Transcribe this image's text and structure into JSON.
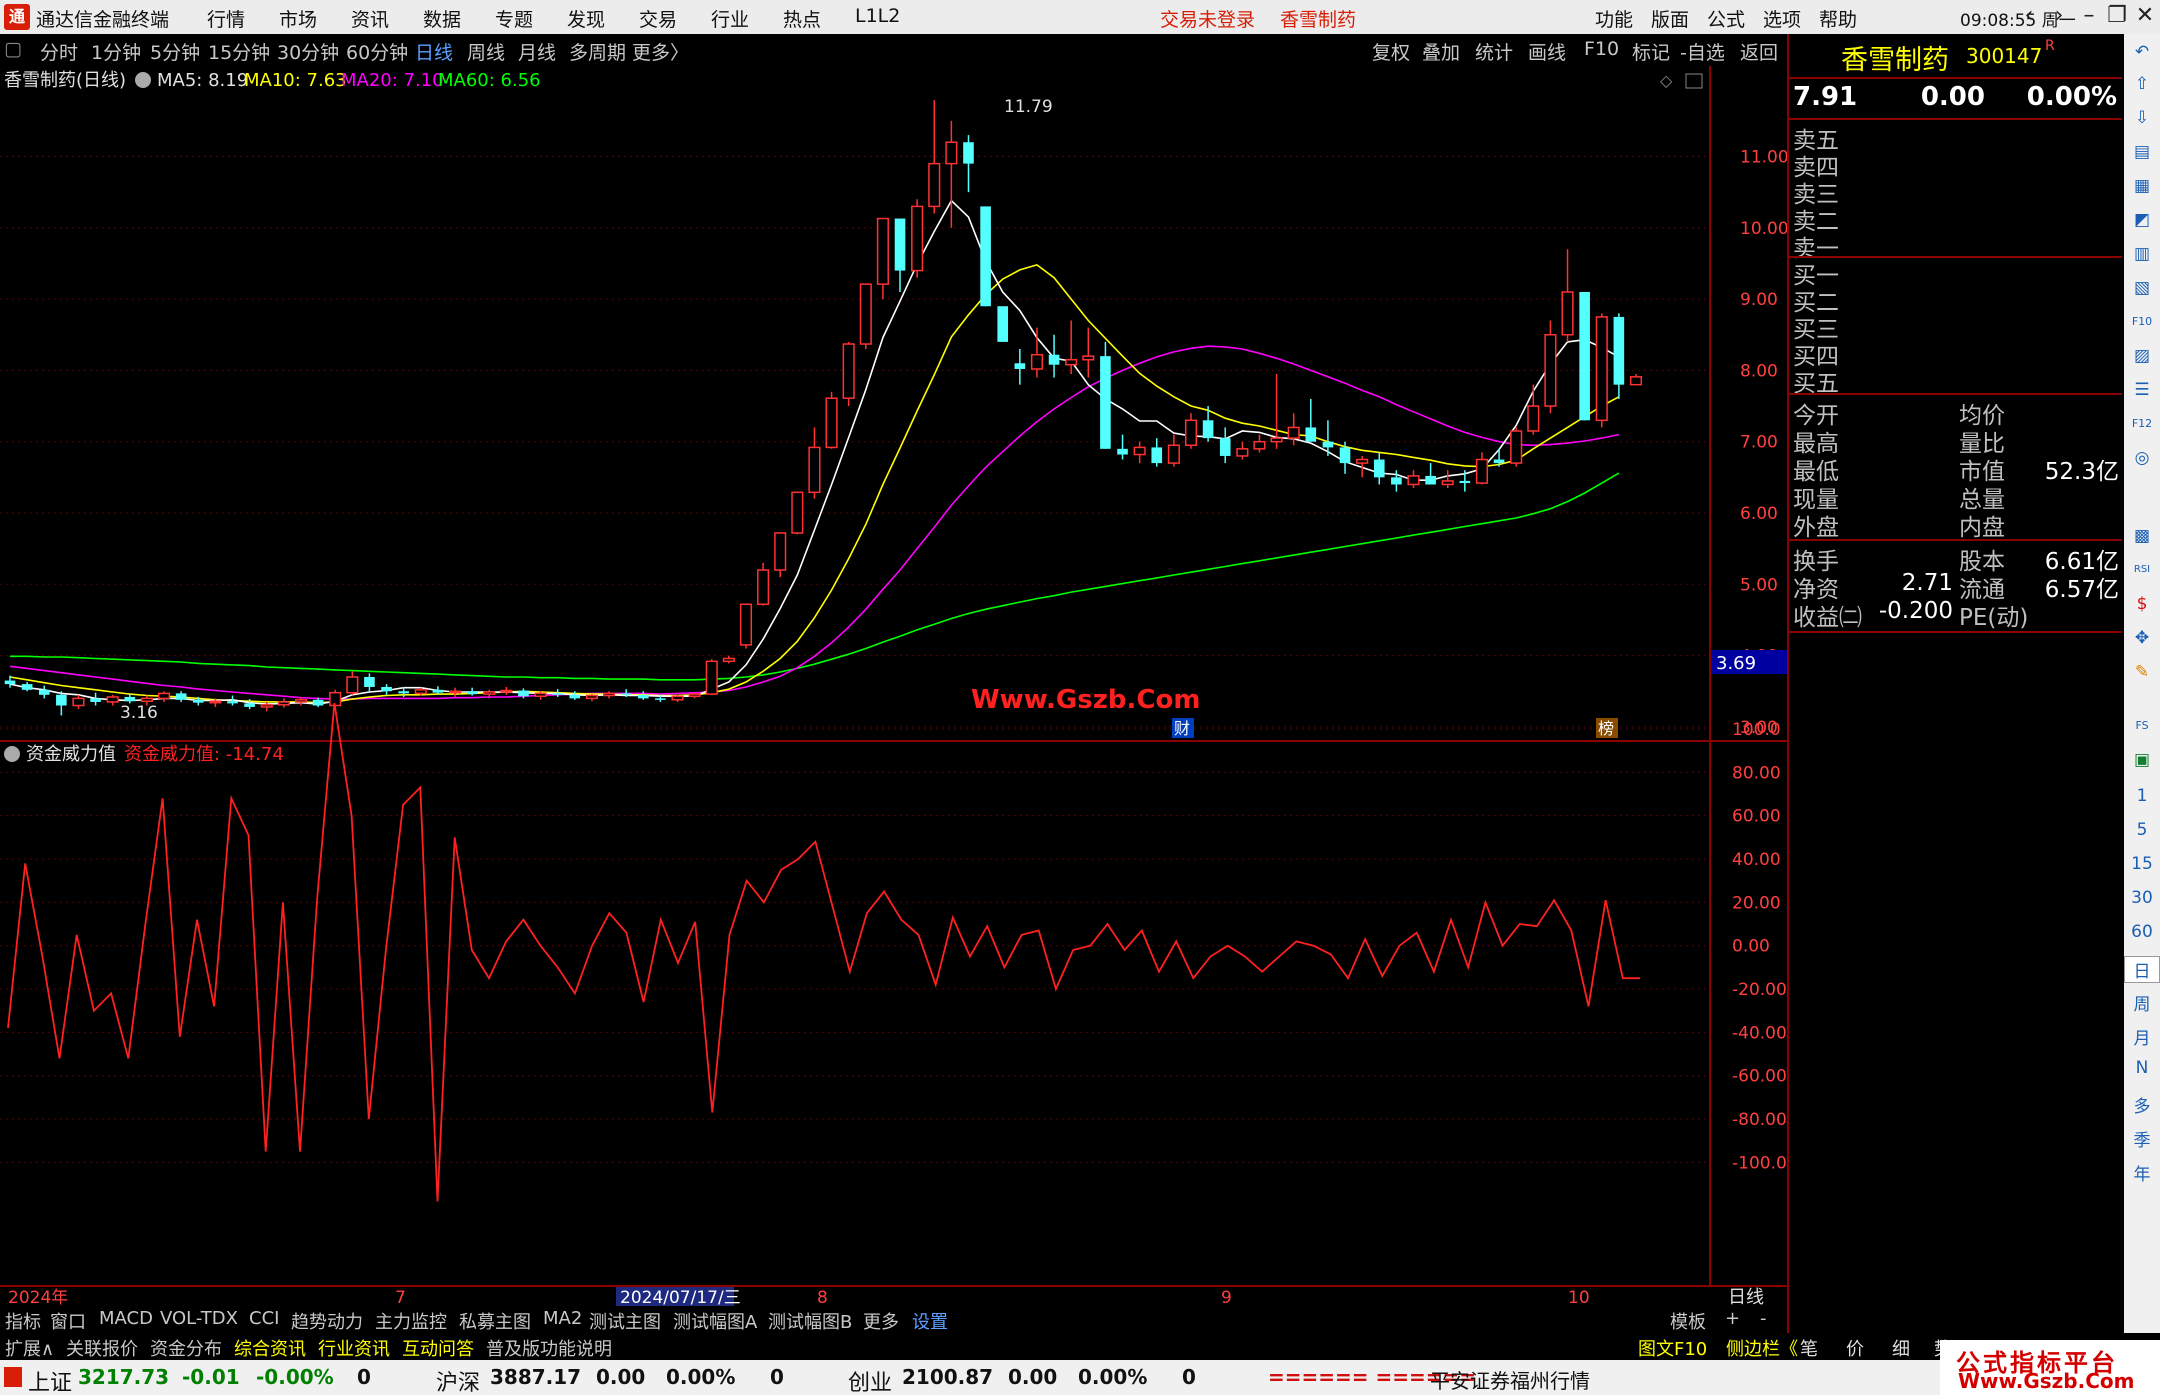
{
  "titlebar": {
    "app_title": "通达信金融终端",
    "menus": [
      "行情",
      "市场",
      "资讯",
      "数据",
      "专题",
      "发现",
      "交易",
      "行业",
      "热点",
      "L1L2"
    ],
    "login_status": "交易未登录",
    "stock_name": "香雪制药",
    "right_menus": [
      "功能",
      "版面",
      "公式",
      "选项",
      "帮助"
    ],
    "clock": "09:08:55 周一",
    "logo_text": "通"
  },
  "periodbar": {
    "periods": [
      "分时",
      "1分钟",
      "5分钟",
      "15分钟",
      "30分钟",
      "60分钟",
      "日线",
      "周线",
      "月线",
      "多周期",
      "更多〉"
    ],
    "active": "日线",
    "tools": [
      "复权",
      "叠加",
      "统计",
      "画线",
      "F10",
      "标记",
      "-自选",
      "返回"
    ]
  },
  "chart_header": {
    "stock_label": "香雪制药(日线)",
    "ma5": "MA5: 8.19",
    "ma10": "MA10: 7.63",
    "ma20": "MA20: 7.10",
    "ma60": "MA60: 6.56",
    "max_label": "11.79",
    "min_label": "3.16",
    "current_price_tag": "3.69",
    "watermark": "Www.Gszb.Com",
    "event_cai": "财",
    "event_bang": "榜"
  },
  "indicator_header": {
    "name": "资金威力值",
    "value_label": "资金威力值: -14.74"
  },
  "x_axis": {
    "labels": [
      "2024年",
      "7",
      "2024/07/17/三",
      "8",
      "9",
      "10"
    ],
    "period_label": "日线"
  },
  "chart_data": [
    {
      "type": "candlestick",
      "title": "香雪制药(日线)",
      "ylim": [
        2.7,
        12.0
      ],
      "yticks": [
        "11.00",
        "10.00",
        "9.00",
        "8.00",
        "7.00",
        "6.00",
        "5.00",
        "4.00",
        "3.00"
      ],
      "colors": {
        "up": "#ff3232",
        "down": "#54ffff",
        "ma5": "#ffffff",
        "ma10": "#ffff00",
        "ma20": "#ff00ff",
        "ma60": "#00ff00"
      },
      "candles": [
        [
          3.65,
          3.72,
          3.55,
          3.6
        ],
        [
          3.6,
          3.63,
          3.5,
          3.52
        ],
        [
          3.52,
          3.58,
          3.4,
          3.45
        ],
        [
          3.45,
          3.5,
          3.16,
          3.3
        ],
        [
          3.3,
          3.45,
          3.25,
          3.4
        ],
        [
          3.4,
          3.48,
          3.3,
          3.35
        ],
        [
          3.35,
          3.45,
          3.3,
          3.42
        ],
        [
          3.42,
          3.46,
          3.33,
          3.36
        ],
        [
          3.36,
          3.44,
          3.3,
          3.4
        ],
        [
          3.4,
          3.5,
          3.35,
          3.47
        ],
        [
          3.47,
          3.5,
          3.35,
          3.38
        ],
        [
          3.38,
          3.42,
          3.3,
          3.34
        ],
        [
          3.34,
          3.4,
          3.28,
          3.36
        ],
        [
          3.36,
          3.44,
          3.3,
          3.33
        ],
        [
          3.33,
          3.39,
          3.25,
          3.28
        ],
        [
          3.28,
          3.35,
          3.22,
          3.31
        ],
        [
          3.31,
          3.4,
          3.27,
          3.35
        ],
        [
          3.35,
          3.42,
          3.3,
          3.38
        ],
        [
          3.38,
          3.41,
          3.28,
          3.3
        ],
        [
          3.3,
          3.52,
          3.28,
          3.48
        ],
        [
          3.48,
          3.78,
          3.45,
          3.7
        ],
        [
          3.7,
          3.75,
          3.5,
          3.56
        ],
        [
          3.56,
          3.6,
          3.45,
          3.5
        ],
        [
          3.5,
          3.56,
          3.42,
          3.47
        ],
        [
          3.47,
          3.55,
          3.44,
          3.52
        ],
        [
          3.52,
          3.57,
          3.45,
          3.48
        ],
        [
          3.48,
          3.55,
          3.42,
          3.5
        ],
        [
          3.5,
          3.55,
          3.44,
          3.46
        ],
        [
          3.46,
          3.52,
          3.4,
          3.49
        ],
        [
          3.49,
          3.56,
          3.45,
          3.51
        ],
        [
          3.51,
          3.54,
          3.4,
          3.43
        ],
        [
          3.43,
          3.5,
          3.38,
          3.47
        ],
        [
          3.47,
          3.53,
          3.42,
          3.45
        ],
        [
          3.45,
          3.5,
          3.38,
          3.4
        ],
        [
          3.4,
          3.46,
          3.36,
          3.44
        ],
        [
          3.44,
          3.5,
          3.4,
          3.47
        ],
        [
          3.47,
          3.53,
          3.42,
          3.45
        ],
        [
          3.45,
          3.5,
          3.38,
          3.4
        ],
        [
          3.4,
          3.45,
          3.35,
          3.38
        ],
        [
          3.38,
          3.45,
          3.35,
          3.43
        ],
        [
          3.43,
          3.48,
          3.4,
          3.46
        ],
        [
          3.46,
          3.95,
          3.45,
          3.92
        ],
        [
          3.92,
          4.0,
          3.89,
          3.96
        ],
        [
          4.15,
          4.5,
          4.1,
          4.72
        ],
        [
          4.72,
          5.3,
          4.7,
          5.2
        ],
        [
          5.2,
          5.7,
          5.1,
          5.72
        ],
        [
          5.72,
          6.3,
          5.7,
          6.29
        ],
        [
          6.29,
          7.2,
          6.2,
          6.92
        ],
        [
          6.92,
          7.7,
          6.9,
          7.61
        ],
        [
          7.61,
          8.4,
          7.5,
          8.37
        ],
        [
          8.37,
          9.2,
          8.3,
          9.21
        ],
        [
          9.21,
          10.13,
          9.0,
          10.13
        ],
        [
          10.13,
          9.8,
          9.1,
          9.4
        ],
        [
          9.4,
          10.4,
          9.3,
          10.3
        ],
        [
          10.3,
          11.79,
          10.2,
          10.9
        ],
        [
          10.9,
          11.5,
          10.0,
          11.2
        ],
        [
          11.2,
          11.3,
          10.5,
          10.9
        ],
        [
          10.3,
          10.3,
          8.9,
          8.9
        ],
        [
          8.9,
          8.6,
          8.4,
          8.4
        ],
        [
          8.1,
          8.3,
          7.8,
          8.02
        ],
        [
          8.02,
          8.6,
          7.9,
          8.22
        ],
        [
          8.22,
          8.5,
          7.9,
          8.08
        ],
        [
          8.08,
          8.7,
          7.95,
          8.15
        ],
        [
          8.15,
          8.6,
          7.9,
          8.2
        ],
        [
          8.2,
          8.4,
          6.9,
          6.9
        ],
        [
          6.9,
          7.1,
          6.75,
          6.82
        ],
        [
          6.82,
          7.0,
          6.7,
          6.92
        ],
        [
          6.92,
          7.05,
          6.65,
          6.7
        ],
        [
          6.7,
          7.1,
          6.65,
          6.95
        ],
        [
          6.95,
          7.4,
          6.9,
          7.3
        ],
        [
          7.3,
          7.5,
          7.0,
          7.05
        ],
        [
          7.05,
          7.2,
          6.7,
          6.8
        ],
        [
          6.8,
          7.0,
          6.75,
          6.9
        ],
        [
          6.9,
          7.1,
          6.85,
          7.0
        ],
        [
          7.0,
          7.95,
          6.9,
          7.05
        ],
        [
          7.05,
          7.4,
          6.95,
          7.2
        ],
        [
          7.2,
          7.6,
          7.0,
          7.0
        ],
        [
          7.0,
          7.3,
          6.8,
          6.92
        ],
        [
          6.92,
          7.0,
          6.55,
          6.7
        ],
        [
          6.7,
          6.8,
          6.5,
          6.75
        ],
        [
          6.75,
          6.85,
          6.4,
          6.5
        ],
        [
          6.5,
          6.6,
          6.3,
          6.4
        ],
        [
          6.4,
          6.6,
          6.35,
          6.52
        ],
        [
          6.52,
          6.7,
          6.4,
          6.4
        ],
        [
          6.4,
          6.6,
          6.35,
          6.45
        ],
        [
          6.45,
          6.6,
          6.3,
          6.42
        ],
        [
          6.42,
          6.85,
          6.4,
          6.75
        ],
        [
          6.75,
          6.9,
          6.65,
          6.7
        ],
        [
          6.7,
          7.2,
          6.65,
          7.15
        ],
        [
          7.15,
          7.8,
          7.1,
          7.5
        ],
        [
          7.5,
          8.7,
          7.4,
          8.5
        ],
        [
          8.5,
          9.7,
          8.4,
          9.1
        ],
        [
          9.1,
          8.5,
          7.3,
          7.3
        ],
        [
          7.3,
          8.8,
          7.2,
          8.75
        ],
        [
          8.75,
          8.8,
          7.6,
          7.8
        ],
        [
          7.8,
          7.95,
          7.85,
          7.91
        ]
      ],
      "ma5": [
        3.6,
        3.55,
        3.52,
        3.47,
        3.45,
        3.4,
        3.38,
        3.37,
        3.38,
        3.4,
        3.4,
        3.37,
        3.37,
        3.38,
        3.34,
        3.32,
        3.33,
        3.34,
        3.32,
        3.36,
        3.45,
        3.49,
        3.51,
        3.55,
        3.55,
        3.51,
        3.49,
        3.49,
        3.49,
        3.49,
        3.48,
        3.47,
        3.47,
        3.45,
        3.44,
        3.45,
        3.44,
        3.44,
        3.43,
        3.43,
        3.43,
        3.53,
        3.63,
        3.87,
        4.23,
        4.66,
        5.13,
        5.76,
        6.4,
        7.06,
        7.73,
        8.46,
        8.97,
        9.49,
        9.95,
        10.38,
        10.15,
        9.54,
        9.1,
        8.84,
        8.46,
        8.17,
        8.13,
        7.8,
        7.6,
        7.46,
        7.29,
        7.29,
        7.12,
        7.08,
        7.07,
        7.04,
        7.15,
        7.13,
        7.06,
        7.04,
        6.98,
        6.86,
        6.72,
        6.64,
        6.56,
        6.54,
        6.46,
        6.46,
        6.52,
        6.55,
        6.62,
        6.89,
        7.23,
        7.71,
        8.09,
        8.4,
        8.43,
        8.32,
        8.19
      ],
      "ma10": [
        3.7,
        3.66,
        3.62,
        3.58,
        3.55,
        3.52,
        3.49,
        3.46,
        3.44,
        3.43,
        3.42,
        3.4,
        3.38,
        3.37,
        3.36,
        3.35,
        3.35,
        3.35,
        3.34,
        3.35,
        3.39,
        3.42,
        3.44,
        3.45,
        3.45,
        3.46,
        3.46,
        3.47,
        3.48,
        3.49,
        3.5,
        3.49,
        3.48,
        3.47,
        3.46,
        3.46,
        3.45,
        3.45,
        3.44,
        3.44,
        3.45,
        3.48,
        3.53,
        3.63,
        3.78,
        3.96,
        4.2,
        4.53,
        4.92,
        5.36,
        5.84,
        6.4,
        6.91,
        7.43,
        7.94,
        8.47,
        8.78,
        9.06,
        9.28,
        9.41,
        9.48,
        9.3,
        9.0,
        8.7,
        8.45,
        8.2,
        7.96,
        7.78,
        7.63,
        7.5,
        7.44,
        7.33,
        7.26,
        7.22,
        7.16,
        7.1,
        7.08,
        7.0,
        6.93,
        6.88,
        6.85,
        6.82,
        6.78,
        6.74,
        6.69,
        6.66,
        6.65,
        6.68,
        6.74,
        6.9,
        7.05,
        7.2,
        7.35,
        7.5,
        7.63
      ],
      "ma20": [
        3.85,
        3.82,
        3.79,
        3.76,
        3.73,
        3.7,
        3.67,
        3.64,
        3.61,
        3.58,
        3.56,
        3.53,
        3.51,
        3.49,
        3.47,
        3.45,
        3.43,
        3.41,
        3.4,
        3.39,
        3.39,
        3.4,
        3.4,
        3.4,
        3.4,
        3.4,
        3.41,
        3.41,
        3.42,
        3.42,
        3.43,
        3.44,
        3.45,
        3.46,
        3.47,
        3.47,
        3.47,
        3.47,
        3.46,
        3.47,
        3.48,
        3.49,
        3.51,
        3.56,
        3.63,
        3.71,
        3.83,
        3.99,
        4.18,
        4.4,
        4.65,
        4.93,
        5.2,
        5.5,
        5.8,
        6.11,
        6.38,
        6.64,
        6.86,
        7.08,
        7.28,
        7.46,
        7.62,
        7.77,
        7.89,
        8.0,
        8.1,
        8.19,
        8.26,
        8.31,
        8.34,
        8.33,
        8.3,
        8.24,
        8.17,
        8.09,
        8.0,
        7.91,
        7.82,
        7.72,
        7.63,
        7.52,
        7.42,
        7.32,
        7.22,
        7.13,
        7.06,
        7.0,
        6.96,
        6.95,
        6.96,
        6.98,
        7.01,
        7.05,
        7.1
      ],
      "ma60": [
        3.99,
        3.99,
        3.98,
        3.98,
        3.97,
        3.96,
        3.95,
        3.94,
        3.93,
        3.92,
        3.91,
        3.89,
        3.88,
        3.87,
        3.86,
        3.84,
        3.83,
        3.82,
        3.81,
        3.8,
        3.79,
        3.78,
        3.77,
        3.76,
        3.75,
        3.74,
        3.73,
        3.72,
        3.71,
        3.7,
        3.7,
        3.69,
        3.69,
        3.68,
        3.68,
        3.67,
        3.67,
        3.67,
        3.66,
        3.66,
        3.66,
        3.67,
        3.68,
        3.7,
        3.73,
        3.77,
        3.82,
        3.88,
        3.95,
        4.02,
        4.1,
        4.19,
        4.27,
        4.36,
        4.44,
        4.52,
        4.59,
        4.65,
        4.7,
        4.75,
        4.8,
        4.84,
        4.89,
        4.93,
        4.97,
        5.01,
        5.05,
        5.09,
        5.13,
        5.17,
        5.21,
        5.25,
        5.29,
        5.33,
        5.37,
        5.41,
        5.45,
        5.49,
        5.53,
        5.57,
        5.61,
        5.65,
        5.69,
        5.73,
        5.77,
        5.81,
        5.85,
        5.89,
        5.93,
        5.99,
        6.06,
        6.16,
        6.28,
        6.42,
        6.56
      ]
    },
    {
      "type": "line",
      "title": "资金威力值",
      "ylim": [
        -120,
        120
      ],
      "yticks": [
        "100.0",
        "80.00",
        "60.00",
        "40.00",
        "20.00",
        "0.00",
        "-20.00",
        "-40.00",
        "-60.00",
        "-80.00",
        "-100.0"
      ],
      "series": [
        {
          "name": "资金威力值",
          "color": "#ff2020",
          "values": [
            -38,
            38,
            -5,
            -52,
            5,
            -30,
            -22,
            -52,
            10,
            68,
            -42,
            12,
            -28,
            68,
            51,
            -95,
            20,
            -95,
            22,
            112,
            60,
            -80,
            -2,
            65,
            73,
            -118,
            50,
            -2,
            -15,
            2,
            12,
            0,
            -10,
            -22,
            0,
            15,
            6,
            -26,
            12,
            -8,
            11,
            -77,
            5,
            30,
            20,
            35,
            40,
            48,
            18,
            -12,
            15,
            25,
            12,
            5,
            -18,
            13,
            -5,
            9,
            -10,
            5,
            7,
            -20,
            -2,
            0,
            10,
            -2,
            7,
            -12,
            2,
            -15,
            -5,
            0,
            -5,
            -12,
            -5,
            2,
            0,
            -4,
            -15,
            3,
            -14,
            0,
            6,
            -12,
            12,
            -10,
            20,
            0,
            10,
            9,
            21,
            7,
            -28,
            21,
            -15,
            -15
          ]
        }
      ]
    }
  ],
  "right_panel": {
    "stock_name": "香雪制药",
    "stock_code": "300147",
    "r_mark": "R",
    "price": "7.91",
    "change": "0.00",
    "change_pct": "0.00%",
    "sell_levels": [
      "卖五",
      "卖四",
      "卖三",
      "卖二",
      "卖一"
    ],
    "buy_levels": [
      "买一",
      "买二",
      "买三",
      "买四",
      "买五"
    ],
    "stats": [
      {
        "l": "今开",
        "lv": "",
        "r": "均价",
        "rv": ""
      },
      {
        "l": "最高",
        "lv": "",
        "r": "量比",
        "rv": ""
      },
      {
        "l": "最低",
        "lv": "",
        "r": "市值",
        "rv": "52.3亿"
      },
      {
        "l": "现量",
        "lv": "",
        "r": "总量",
        "rv": ""
      },
      {
        "l": "外盘",
        "lv": "",
        "r": "内盘",
        "rv": ""
      }
    ],
    "stats2": [
      {
        "l": "换手",
        "lv": "",
        "r": "股本",
        "rv": "6.61亿"
      },
      {
        "l": "净资",
        "lv": "2.71",
        "r": "流通",
        "rv": "6.57亿"
      },
      {
        "l": "收益㈡",
        "lv": "-0.200",
        "r": "PE(动)",
        "rv": ""
      }
    ]
  },
  "iconbar": {
    "icons": [
      "↶",
      "⇧",
      "⇩",
      "▤",
      "▦",
      "◩",
      "▥",
      "▧",
      "F10",
      "▨",
      "☰",
      "F12",
      "◎",
      "▩",
      "RSI",
      "$",
      "✥",
      "✎",
      "FS",
      "▣"
    ],
    "periods": [
      "1",
      "5",
      "15",
      "30",
      "60",
      "日",
      "周",
      "月",
      "N",
      "多",
      "季",
      "年"
    ]
  },
  "indicator_tabs": [
    "指标",
    "窗口",
    "MACD",
    "VOL-TDX",
    "CCI",
    "趋势动力",
    "主力监控",
    "私募主图",
    "MA2",
    "测试主图",
    "测试幅图A",
    "测试幅图B",
    "更多",
    "设置"
  ],
  "indicator_tabs_right": [
    "模板",
    "+",
    "-"
  ],
  "ext_tabs": [
    "扩展∧",
    "关联报价",
    "资金分布",
    "综合资讯",
    "行业资讯",
    "互动问答",
    "普及版功能说明"
  ],
  "ext_right": [
    "图文F10",
    "侧边栏《",
    "笔",
    "价",
    "细",
    "势"
  ],
  "statusbar": {
    "sh_name": "上证",
    "sh_val": "3217.73",
    "sh_chg": "-0.01",
    "sh_pct": "-0.00%",
    "sh_vol": "0",
    "hs_name": "沪深",
    "hs_val": "3887.17",
    "hs_chg": "0.00",
    "hs_pct": "0.00%",
    "hs_vol": "0",
    "cy_name": "创业",
    "cy_val": "2100.87",
    "cy_chg": "0.00",
    "cy_pct": "0.00%",
    "cy_vol": "0",
    "bars": "====== ======",
    "broker": "平安证券福州行情"
  },
  "corner_watermark": {
    "line1": "公式指标平台",
    "line2": "Www.Gszb.Com"
  }
}
